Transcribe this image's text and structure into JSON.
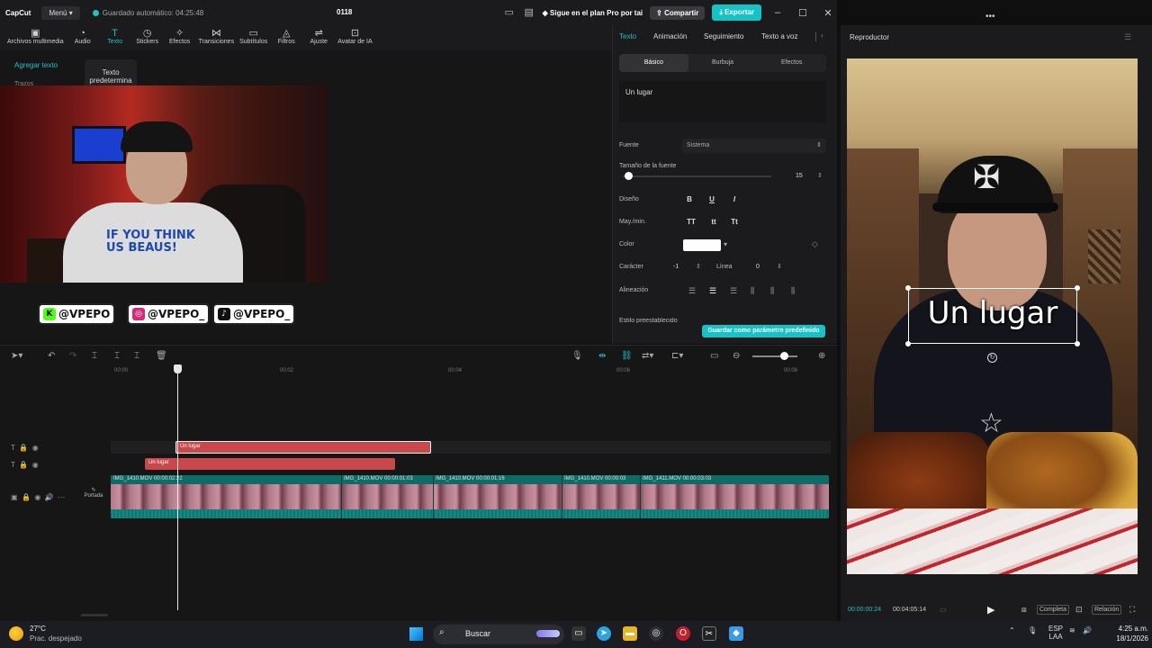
{
  "app": {
    "logo": "CapCut",
    "menu_label": "Menú",
    "autosave": "Guardado automático: 04:25:48",
    "project_title": "0118",
    "pro_link": "Sigue en el plan Pro por tai",
    "share_label": "Compartir",
    "export_label": "Exportar",
    "accent": "#22c1c3"
  },
  "toolbar": {
    "items": [
      {
        "label": "Archivos multimedia",
        "icon": "media-icon"
      },
      {
        "label": "Audio",
        "icon": "audio-icon"
      },
      {
        "label": "Texto",
        "icon": "text-icon"
      },
      {
        "label": "Stickers",
        "icon": "sticker-icon"
      },
      {
        "label": "Efectos",
        "icon": "effects-icon"
      },
      {
        "label": "Transiciones",
        "icon": "transitions-icon"
      },
      {
        "label": "Subtítulos",
        "icon": "subtitles-icon"
      },
      {
        "label": "Filtros",
        "icon": "filters-icon"
      },
      {
        "label": "Ajuste",
        "icon": "adjust-icon"
      },
      {
        "label": "Avatar de IA",
        "icon": "ai-avatar-icon"
      }
    ],
    "active": "Texto"
  },
  "left_panel": {
    "add_text": "Agregar texto",
    "sub_label": "Trazos",
    "preset_card": "Texto predetermina"
  },
  "overlay": {
    "shirt_text": "IF YOU THINK US BEAUS!",
    "socials": [
      {
        "handle": "@VPEPO",
        "icon": "kick-icon",
        "color": "#53fc18"
      },
      {
        "handle": "@VPEPO_",
        "icon": "instagram-icon",
        "color": "#d62976"
      },
      {
        "handle": "@VPEPO_",
        "icon": "tiktok-icon",
        "color": "#111111"
      }
    ]
  },
  "props": {
    "tabs": [
      "Texto",
      "Animación",
      "Seguimiento",
      "Texto a voz"
    ],
    "active_tab": "Texto",
    "subtabs": [
      "Básico",
      "Burbuja",
      "Efectos"
    ],
    "active_subtab": "Básico",
    "text_value": "Un lugar",
    "font_label": "Fuente",
    "font_value": "Sistema",
    "size_label": "Tamaño de la fuente",
    "size_value": "15",
    "size_level": 0.03,
    "design_label": "Diseño",
    "design_buttons": [
      "B",
      "U",
      "I"
    ],
    "case_label": "May./min.",
    "case_buttons": [
      "TT",
      "tt",
      "Tt"
    ],
    "color_label": "Color",
    "color_value": "#ffffff",
    "char_label": "Carácter",
    "char_value": "-1",
    "line_label": "Línea",
    "line_value": "0",
    "align_label": "Alineación",
    "preset_label": "Estilo preestablecido",
    "save_preset": "Guardar como parámetro predefinido"
  },
  "timeline": {
    "ruler": [
      "00:00",
      "00:02",
      "00:04",
      "00:06",
      "00:08"
    ],
    "text_clip_1": "Un lugar",
    "text_clip_2": "Un lugar",
    "video_clips": [
      "IMG_1410.MOV   00:00:02:22",
      "IMG_1410.MOV   00:00:01:03",
      "IMG_1410.MOV   00:00:01:16",
      "IMG_1410.MOV   00:00:03",
      "IMG_1411.MOV   00:00:03:03"
    ],
    "cover_label": "Portada"
  },
  "player": {
    "title": "Reproductor",
    "caption": "Un lugar",
    "current_time": "00:00:00:24",
    "total_time": "00:04:05:14",
    "full_label": "Completa",
    "ratio_label": "Relación"
  },
  "taskbar": {
    "temp": "27°C",
    "weather": "Prac. despejado",
    "search": "Buscar",
    "lang": "ESP",
    "lang2": "LAA",
    "time": "4:25 a.m.",
    "date": "18/1/2026"
  }
}
